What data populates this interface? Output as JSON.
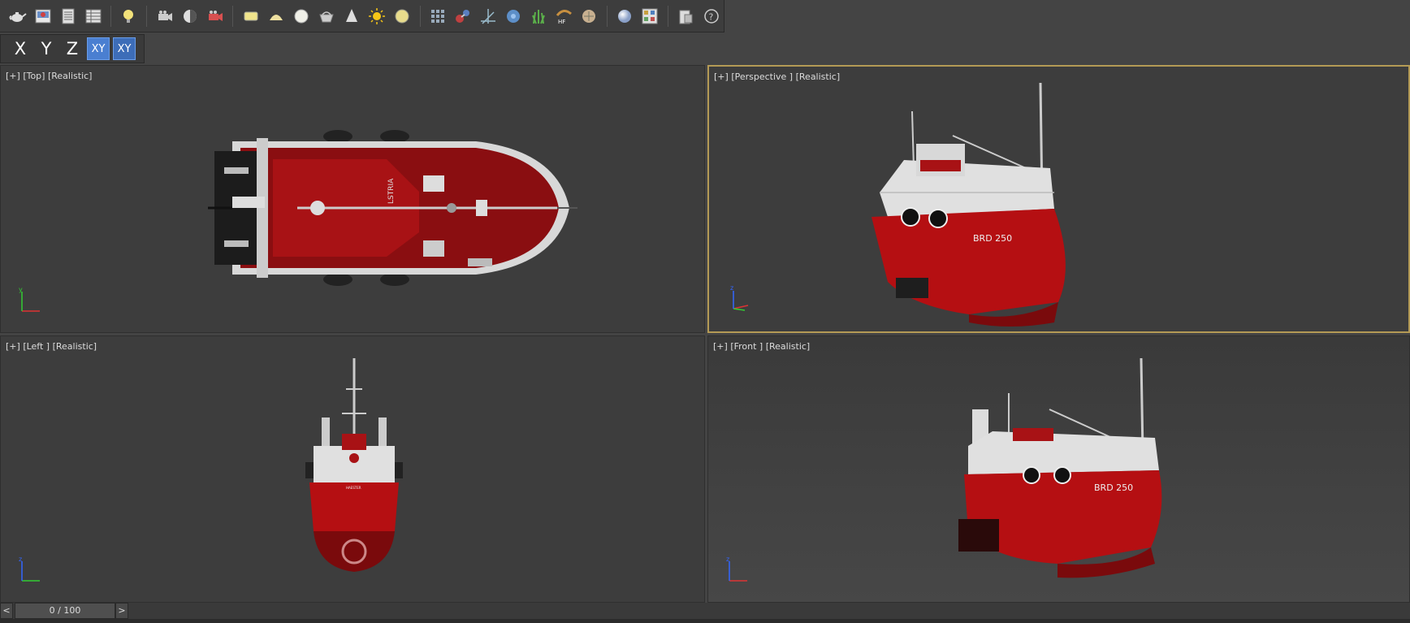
{
  "toolbar": {
    "icons": [
      "teapot-icon",
      "render-setup-icon",
      "rendered-frame-icon",
      "render-table-icon",
      "light-icon",
      "camera-icon",
      "helper-icon",
      "camera-rig-icon",
      "plane-icon",
      "dome-icon",
      "sphere-icon",
      "basket-icon",
      "cone-icon",
      "sun-icon",
      "disc-icon",
      "grid-icon",
      "molecule-icon",
      "compass-icon",
      "gear-flower-icon",
      "grass-icon",
      "hair-fur-icon",
      "fiber-icon",
      "material-sphere-icon",
      "material-editor-icon",
      "clipboard-icon",
      "help-icon"
    ],
    "hair_label": "HF"
  },
  "axis_constraints": {
    "x": "X",
    "y": "Y",
    "z": "Z",
    "xy": "XY",
    "xy_snap": "XY"
  },
  "viewports": {
    "top": {
      "plus": "[+]",
      "view": "[Top]",
      "shading": "[Realistic]"
    },
    "perspective": {
      "plus": "[+]",
      "view": "[Perspective ]",
      "shading": "[Realistic]"
    },
    "left": {
      "plus": "[+]",
      "view": "[Left ]",
      "shading": "[Realistic]"
    },
    "front": {
      "plus": "[+]",
      "view": "[Front ]",
      "shading": "[Realistic]"
    }
  },
  "boat": {
    "registration": "BRD 250",
    "deck_text": "LSTRIA",
    "stern_text": "HAESTER"
  },
  "timeline": {
    "prev": "<",
    "next": ">",
    "frame": "0 / 100"
  },
  "colors": {
    "hull_red": "#b50f12",
    "hull_dark": "#7a0a0c",
    "cabin_white": "#e8e8e8",
    "active_border": "#b49a55",
    "axis_active": "#4a7fd1"
  }
}
